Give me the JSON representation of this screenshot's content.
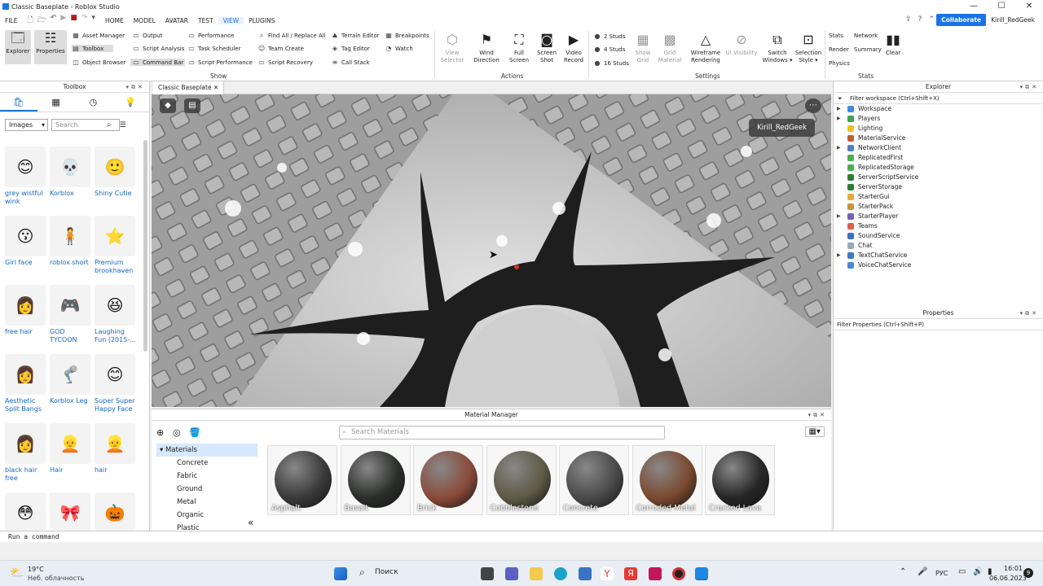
{
  "window": {
    "title": "Classic Baseplate - Roblox Studio"
  },
  "menu": {
    "items": [
      "FILE",
      "HOME",
      "MODEL",
      "AVATAR",
      "TEST",
      "VIEW",
      "PLUGINS"
    ],
    "active": "VIEW"
  },
  "header": {
    "collaborate": "Collaborate",
    "user": "Kirill_RedGeek"
  },
  "ribbon": {
    "explorer": "Explorer",
    "properties": "Properties",
    "asset_manager": "Asset Manager",
    "toolbox": "Toolbox",
    "object_browser": "Object Browser",
    "output": "Output",
    "script_analysis": "Script Analysis",
    "command_bar": "Command Bar",
    "performance": "Performance",
    "task_scheduler": "Task Scheduler",
    "script_performance": "Script Performance",
    "find_all": "Find All / Replace All",
    "team_create": "Team Create",
    "script_recovery": "Script Recovery",
    "terrain_editor": "Terrain Editor",
    "tag_editor": "Tag Editor",
    "call_stack": "Call Stack",
    "breakpoints": "Breakpoints",
    "watch": "Watch",
    "show_group": "Show",
    "view_selector": "View\nSelector",
    "wind_direction": "Wind\nDirection",
    "full_screen": "Full\nScreen",
    "screen_shot": "Screen\nShot",
    "video_record": "Video\nRecord",
    "actions_group": "Actions",
    "studs2": "2 Studs",
    "studs4": "4 Studs",
    "studs16": "16 Studs",
    "show_grid": "Show\nGrid",
    "grid_material": "Grid\nMaterial",
    "wireframe": "Wireframe\nRendering",
    "ui_visibility": "UI Visibility",
    "switch_windows": "Switch\nWindows ▾",
    "selection_style": "Selection\nStyle ▾",
    "settings_group": "Settings",
    "stats": "Stats",
    "network": "Network",
    "render": "Render",
    "summary": "Summary",
    "physics": "Physics",
    "clear": "Clear",
    "stats_group": "Stats"
  },
  "toolbox": {
    "title": "Toolbox",
    "category": "Images",
    "search_placeholder": "Search",
    "items": [
      {
        "name": "grey wistful wink",
        "glyph": "😊"
      },
      {
        "name": "Korblox",
        "glyph": "💀"
      },
      {
        "name": "Shiny Cutie",
        "glyph": "🙂"
      },
      {
        "name": "Girl face",
        "glyph": "😗"
      },
      {
        "name": "roblox short",
        "glyph": "🧍"
      },
      {
        "name": "Premium brookhaven",
        "glyph": "⭐"
      },
      {
        "name": "free hair",
        "glyph": "👩"
      },
      {
        "name": "GOD TYCOON",
        "glyph": "🎮"
      },
      {
        "name": "Laughing Fun (2015-...",
        "glyph": "😆"
      },
      {
        "name": "Aesthetic Split Bangs",
        "glyph": "👩"
      },
      {
        "name": "Korblox Leg",
        "glyph": "🦿"
      },
      {
        "name": "Super Super Happy Face",
        "glyph": "😊"
      },
      {
        "name": "black hair free",
        "glyph": "👩"
      },
      {
        "name": "Hair",
        "glyph": "👱"
      },
      {
        "name": "hair",
        "glyph": "👱"
      },
      {
        "name": "",
        "glyph": "😳"
      },
      {
        "name": "",
        "glyph": "🎀"
      },
      {
        "name": "",
        "glyph": "🎃"
      }
    ]
  },
  "viewport": {
    "tab": "Classic Baseplate",
    "player_name": "Kirill_RedGeek"
  },
  "material_manager": {
    "title": "Material Manager",
    "search_placeholder": "Search Materials",
    "tree": [
      "Materials",
      "Concrete",
      "Fabric",
      "Ground",
      "Metal",
      "Organic",
      "Plastic"
    ],
    "tiles": [
      {
        "name": "Asphalt",
        "color": "#3a3a3a"
      },
      {
        "name": "Basalt",
        "color": "#2b2e2b"
      },
      {
        "name": "Brick",
        "color": "#8a4b3a"
      },
      {
        "name": "Cobblestone",
        "color": "#5e5a45"
      },
      {
        "name": "Concrete",
        "color": "#4a4a4a"
      },
      {
        "name": "Corroded Metal",
        "color": "#7a4a30"
      },
      {
        "name": "Cracked Lava",
        "color": "#262626"
      }
    ]
  },
  "explorer": {
    "title": "Explorer",
    "filter": "Filter workspace (Ctrl+Shift+X)",
    "items": [
      {
        "label": "Workspace",
        "color": "#3b8be0",
        "arrow": true
      },
      {
        "label": "Players",
        "color": "#3fa34d",
        "arrow": true
      },
      {
        "label": "Lighting",
        "color": "#f0c020",
        "arrow": false
      },
      {
        "label": "MaterialService",
        "color": "#c06030",
        "arrow": false
      },
      {
        "label": "NetworkClient",
        "color": "#5080c0",
        "arrow": true
      },
      {
        "label": "ReplicatedFirst",
        "color": "#4caf50",
        "arrow": false
      },
      {
        "label": "ReplicatedStorage",
        "color": "#4caf50",
        "arrow": false
      },
      {
        "label": "ServerScriptService",
        "color": "#2e7d32",
        "arrow": false
      },
      {
        "label": "ServerStorage",
        "color": "#2e7d32",
        "arrow": false
      },
      {
        "label": "StarterGui",
        "color": "#e5a93c",
        "arrow": false
      },
      {
        "label": "StarterPack",
        "color": "#d09038",
        "arrow": false
      },
      {
        "label": "StarterPlayer",
        "color": "#7a5fb8",
        "arrow": true
      },
      {
        "label": "Teams",
        "color": "#e0604a",
        "arrow": false
      },
      {
        "label": "SoundService",
        "color": "#3d6fc4",
        "arrow": false
      },
      {
        "label": "Chat",
        "color": "#9aa8b8",
        "arrow": false
      },
      {
        "label": "TextChatService",
        "color": "#3c7ac8",
        "arrow": true
      },
      {
        "label": "VoiceChatService",
        "color": "#4a89d4",
        "arrow": false
      }
    ]
  },
  "properties": {
    "title": "Properties",
    "filter": "Filter Properties (Ctrl+Shift+P)"
  },
  "command_bar": {
    "placeholder": "Run a command"
  },
  "taskbar": {
    "weather_temp": "19°C",
    "weather_desc": "Неб. облачность",
    "search": "Поиск",
    "lang": "РУС",
    "time": "16:01",
    "date": "06.06.2023",
    "badge": "9"
  }
}
